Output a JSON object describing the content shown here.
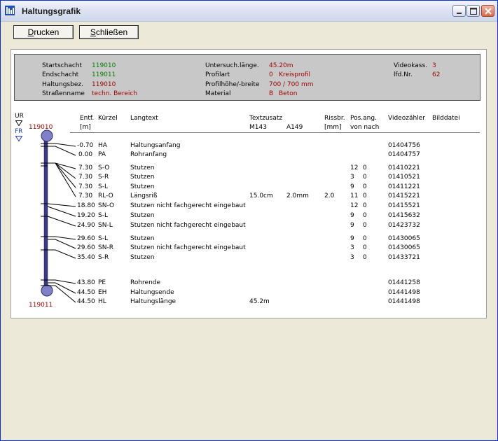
{
  "window": {
    "title": "Haltungsgrafik"
  },
  "toolbar": {
    "print_pre": "",
    "print_ul": "D",
    "print_post": "rucken",
    "close_pre": "",
    "close_ul": "S",
    "close_post": "chließen"
  },
  "info": {
    "startschacht_label": "Startschacht",
    "startschacht_value": "119010",
    "endschacht_label": "Endschacht",
    "endschacht_value": "119011",
    "haltungsbez_label": "Haltungsbez.",
    "haltungsbez_value": "119010",
    "strasse_label": "Straßenname",
    "strasse_value": "techn. Bereich",
    "untersuch_label": "Untersuch.länge.",
    "untersuch_value": "45.20m",
    "profilart_label": "Profilart",
    "profilart_code": "0",
    "profilart_value": "Kreisprofil",
    "profilhoehe_label": "Profilhöhe/-breite",
    "profilhoehe_value": "700 / 700 mm",
    "material_label": "Material",
    "material_code": "B",
    "material_value": "Beton",
    "videokass_label": "Videokass.",
    "videokass_value": "3",
    "lfdnr_label": "lfd.Nr.",
    "lfdnr_value": "62"
  },
  "graph": {
    "ur_label": "UR",
    "fr_label": "FR",
    "start_node": "119010",
    "end_node": "119011"
  },
  "columns": {
    "entf": "Entf.",
    "entf_unit": "[m]",
    "kuerzel": "Kürzel",
    "langtext": "Langtext",
    "textzusatz": "Textzusatz",
    "m143": "M143",
    "a149": "A149",
    "rissbr": "Rissbr.",
    "rissbr_unit": "[mm]",
    "posang": "Pos.ang.",
    "posang_sub": "von nach",
    "videozaehler": "Videozähler",
    "bilddatei": "Bilddatei"
  },
  "rows": [
    {
      "entf": "-0.70",
      "k": "HA",
      "text": "Haltungsanfang",
      "m143": "",
      "a149": "",
      "riss": "",
      "von": "",
      "nach": "",
      "video": "01404756"
    },
    {
      "entf": "0.00",
      "k": "PA",
      "text": "Rohranfang",
      "m143": "",
      "a149": "",
      "riss": "",
      "von": "",
      "nach": "",
      "video": "01404757"
    },
    {
      "entf": "7.30",
      "k": "S-O",
      "text": "Stutzen",
      "m143": "",
      "a149": "",
      "riss": "",
      "von": "12",
      "nach": "0",
      "video": "01410221"
    },
    {
      "entf": "7.30",
      "k": "S-R",
      "text": "Stutzen",
      "m143": "",
      "a149": "",
      "riss": "",
      "von": "3",
      "nach": "0",
      "video": "01410521"
    },
    {
      "entf": "7.30",
      "k": "S-L",
      "text": "Stutzen",
      "m143": "",
      "a149": "",
      "riss": "",
      "von": "9",
      "nach": "0",
      "video": "01411221"
    },
    {
      "entf": "7.30",
      "k": "RL-O",
      "text": "Längsriß",
      "m143": "15.0cm",
      "a149": "2.0mm",
      "riss": "2.0",
      "von": "11",
      "nach": "0",
      "video": "01415221"
    },
    {
      "entf": "18.80",
      "k": "SN-O",
      "text": "Stutzen nicht fachgerecht eingebaut",
      "m143": "",
      "a149": "",
      "riss": "",
      "von": "12",
      "nach": "0",
      "video": "01415521"
    },
    {
      "entf": "19.20",
      "k": "S-L",
      "text": "Stutzen",
      "m143": "",
      "a149": "",
      "riss": "",
      "von": "9",
      "nach": "0",
      "video": "01415632"
    },
    {
      "entf": "24.90",
      "k": "SN-L",
      "text": "Stutzen nicht fachgerecht eingebaut",
      "m143": "",
      "a149": "",
      "riss": "",
      "von": "9",
      "nach": "0",
      "video": "01423732"
    },
    {
      "entf": "29.60",
      "k": "S-L",
      "text": "Stutzen",
      "m143": "",
      "a149": "",
      "riss": "",
      "von": "9",
      "nach": "0",
      "video": "01430065"
    },
    {
      "entf": "29.60",
      "k": "SN-R",
      "text": "Stutzen nicht fachgerecht eingebaut",
      "m143": "",
      "a149": "",
      "riss": "",
      "von": "3",
      "nach": "0",
      "video": "01430065"
    },
    {
      "entf": "35.40",
      "k": "S-R",
      "text": "Stutzen",
      "m143": "",
      "a149": "",
      "riss": "",
      "von": "3",
      "nach": "0",
      "video": "01433721"
    },
    {
      "entf": "43.80",
      "k": "PE",
      "text": "Rohrende",
      "m143": "",
      "a149": "",
      "riss": "",
      "von": "",
      "nach": "",
      "video": "01441258"
    },
    {
      "entf": "44.50",
      "k": "EH",
      "text": "Haltungsende",
      "m143": "",
      "a149": "",
      "riss": "",
      "von": "",
      "nach": "",
      "video": "01441498"
    },
    {
      "entf": "44.50",
      "k": "HL",
      "text": "Haltungslänge",
      "m143": "45.2m",
      "a149": "",
      "riss": "",
      "von": "",
      "nach": "",
      "video": "01441498"
    }
  ],
  "colors": {
    "accent_red": "#9b0000",
    "accent_green": "#008000",
    "pipe": "#3a3a8c",
    "node": "#8080c8"
  }
}
